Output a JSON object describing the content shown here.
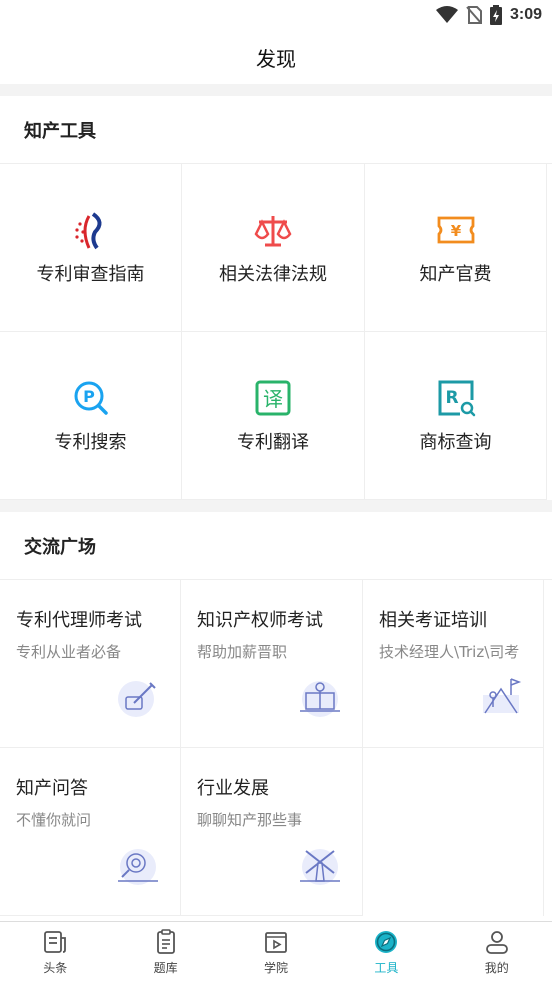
{
  "status_bar": {
    "time": "3:09"
  },
  "header": {
    "title": "发现"
  },
  "tools_section": {
    "title": "知产工具",
    "items": [
      {
        "label": "专利审查指南",
        "icon": "patent-office-logo-icon"
      },
      {
        "label": "相关法律法规",
        "icon": "scale-icon"
      },
      {
        "label": "知产官费",
        "icon": "yen-ticket-icon"
      },
      {
        "label": "专利搜索",
        "icon": "patent-search-icon"
      },
      {
        "label": "专利翻译",
        "icon": "translate-icon"
      },
      {
        "label": "商标查询",
        "icon": "trademark-search-icon"
      }
    ]
  },
  "community_section": {
    "title": "交流广场",
    "items": [
      {
        "title": "专利代理师考试",
        "subtitle": "专利从业者必备",
        "icon": "writing-illustration"
      },
      {
        "title": "知识产权师考试",
        "subtitle": "帮助加薪晋职",
        "icon": "graduate-illustration"
      },
      {
        "title": "相关考证培训",
        "subtitle": "技术经理人\\Triz\\司考",
        "icon": "climber-illustration"
      },
      {
        "title": "知产问答",
        "subtitle": "不懂你就问",
        "icon": "qa-magnifier-illustration"
      },
      {
        "title": "行业发展",
        "subtitle": "聊聊知产那些事",
        "icon": "windmill-illustration"
      }
    ]
  },
  "tab_bar": {
    "active_color": "#1cb3c8",
    "items": [
      {
        "label": "头条",
        "icon": "news-icon"
      },
      {
        "label": "题库",
        "icon": "question-bank-icon"
      },
      {
        "label": "学院",
        "icon": "video-play-icon"
      },
      {
        "label": "工具",
        "icon": "compass-icon",
        "active": true
      },
      {
        "label": "我的",
        "icon": "user-icon"
      }
    ]
  }
}
